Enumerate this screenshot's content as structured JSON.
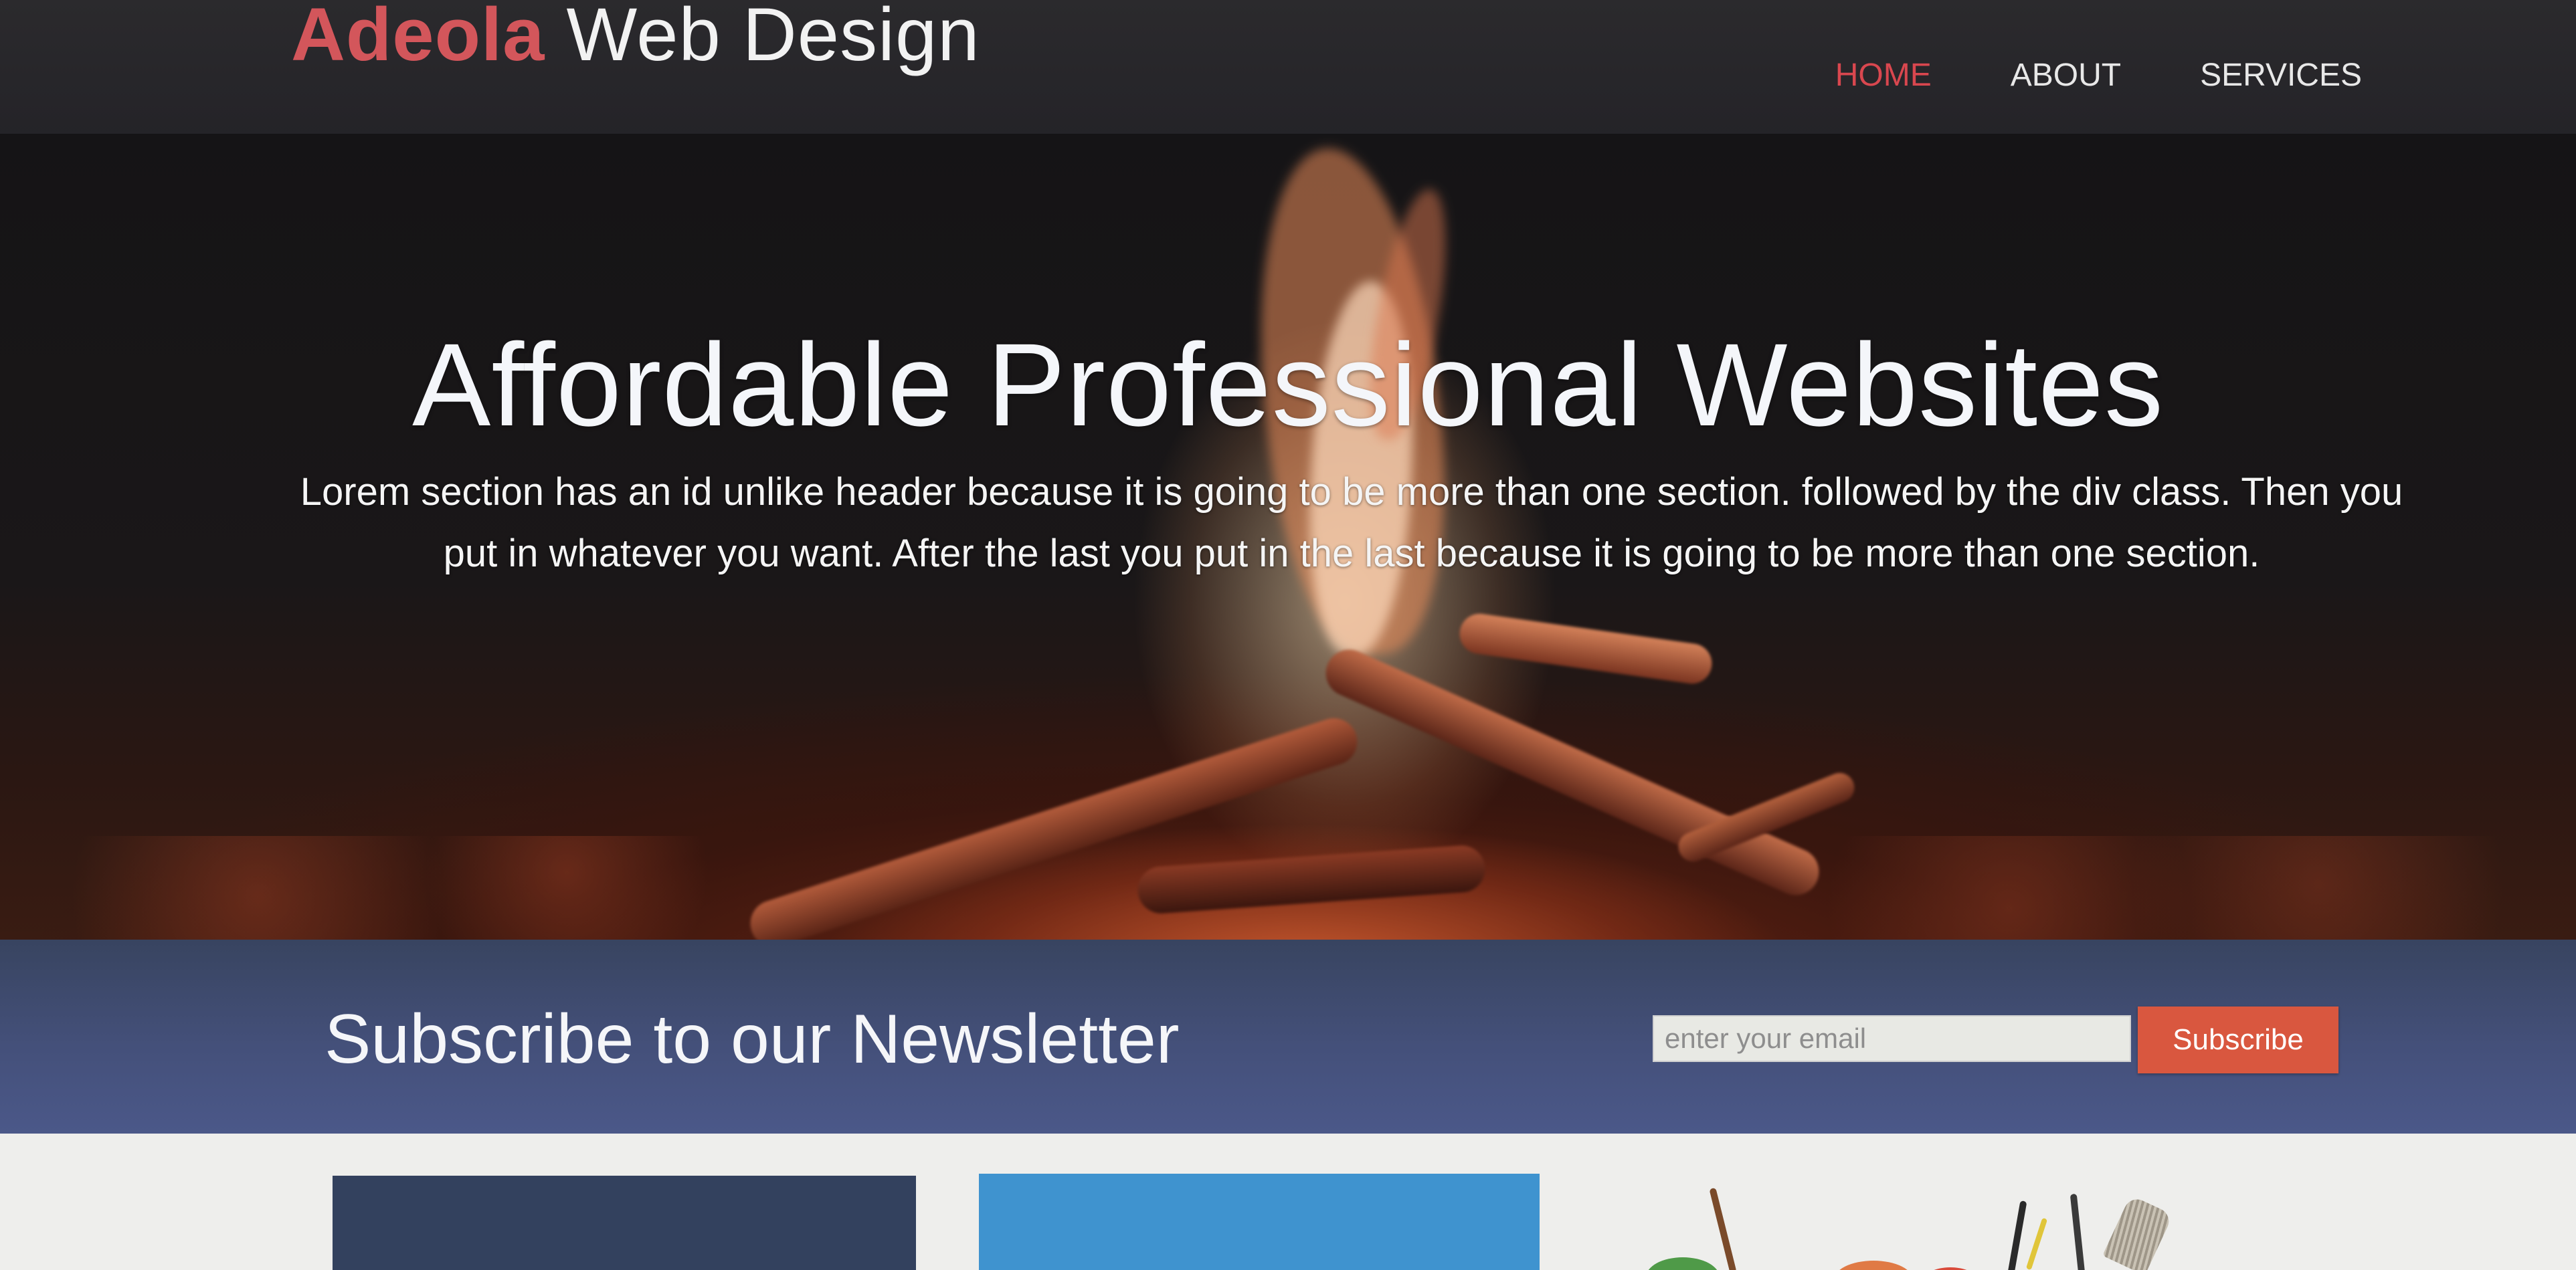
{
  "header": {
    "brand_accent": "Adeola",
    "brand_rest": "Web Design",
    "nav": [
      {
        "label": "HOME",
        "active": true
      },
      {
        "label": "ABOUT",
        "active": false
      },
      {
        "label": "SERVICES",
        "active": false
      }
    ]
  },
  "showcase": {
    "title": "Affordable Professional Websites",
    "text": "Lorem section has an id unlike header because it is going to be more than one section. followed by the div class. Then you put in whatever you want. After the last you put in the last because it is going to be more than one section."
  },
  "newsletter": {
    "title": "Subscribe to our Newsletter",
    "email_placeholder": "enter your email",
    "email_value": "",
    "button_label": "Subscribe"
  },
  "colors": {
    "accent_red": "#d3565b",
    "header_bg": "#2b2a2d",
    "newsletter_bg": "#44507a",
    "subscribe_button": "#d9573f"
  }
}
